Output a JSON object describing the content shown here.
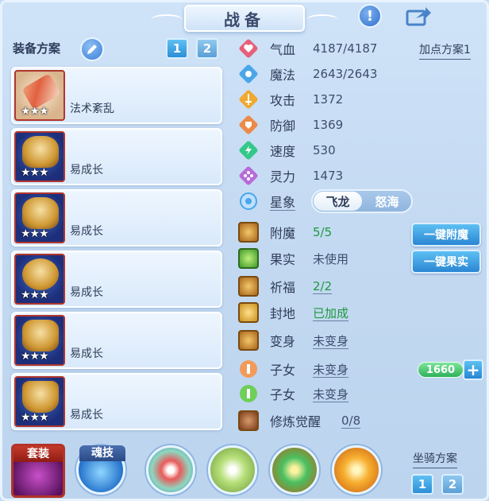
{
  "window": {
    "title": "战备"
  },
  "equip_plan": {
    "label": "装备方案",
    "plans": [
      "1",
      "2"
    ],
    "items": [
      {
        "name": "法术紊乱",
        "stars": "★★★"
      },
      {
        "name": "易成长",
        "stars": "★★★"
      },
      {
        "name": "易成长",
        "stars": "★★★"
      },
      {
        "name": "易成长",
        "stars": "★★★"
      },
      {
        "name": "易成长",
        "stars": "★★★"
      },
      {
        "name": "易成长",
        "stars": "★★★"
      }
    ]
  },
  "stats": {
    "plan_link": "加点方案1",
    "items": [
      {
        "label": "气血",
        "value": "4187/4187",
        "icon": "heart-icon",
        "color": "#e7607a"
      },
      {
        "label": "魔法",
        "value": "2643/2643",
        "icon": "mana-icon",
        "color": "#4aa6e8"
      },
      {
        "label": "攻击",
        "value": "1372",
        "icon": "sword-icon",
        "color": "#f0a830"
      },
      {
        "label": "防御",
        "value": "1369",
        "icon": "shield-icon",
        "color": "#ec8a4a"
      },
      {
        "label": "速度",
        "value": "530",
        "icon": "lightning-icon",
        "color": "#34c78a"
      },
      {
        "label": "灵力",
        "value": "1473",
        "icon": "spirit-icon",
        "color": "#b86ad8"
      }
    ],
    "constellation": {
      "label": "星象",
      "options": [
        "飞龙",
        "怒海"
      ],
      "selected": "飞龙"
    }
  },
  "enhance": {
    "items": [
      {
        "label": "附魔",
        "value": "5/5",
        "value_color": "green"
      },
      {
        "label": "果实",
        "value": "未使用",
        "value_color": "normal"
      },
      {
        "label": "祈福",
        "value": "2/2",
        "value_color": "green"
      },
      {
        "label": "封地",
        "value": "已加成",
        "value_color": "green"
      },
      {
        "label": "变身",
        "value": "未变身",
        "value_color": "normal"
      },
      {
        "label": "子女",
        "value": "未变身",
        "value_color": "normal"
      },
      {
        "label": "子女",
        "value": "未变身",
        "value_color": "normal"
      },
      {
        "label": "修炼觉醒",
        "value": "0/8",
        "value_color": "normal"
      }
    ],
    "buttons": {
      "enchant": "一键附魔",
      "fruit": "一键果实"
    },
    "child_score": "1660",
    "plus": "+"
  },
  "bottom": {
    "suit_label": "套装",
    "soul_label": "魂技",
    "mount_plan_label": "坐骑方案",
    "mount_plans": [
      "1",
      "2"
    ]
  }
}
